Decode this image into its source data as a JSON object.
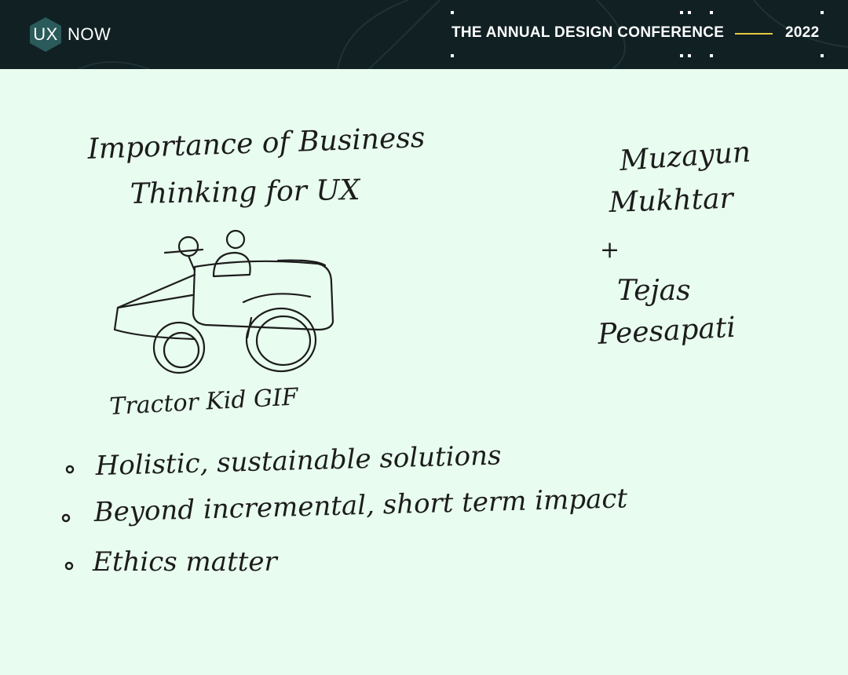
{
  "header": {
    "logo": {
      "ux": "UX",
      "now": "NOW"
    },
    "conference_title": "THE ANNUAL DESIGN CONFERENCE",
    "year": "2022"
  },
  "slide": {
    "title_line1": "Importance of Business",
    "title_line2": "Thinking for UX",
    "sketch_caption": "Tractor Kid GIF",
    "speakers": {
      "speaker1_first": "Muzayun",
      "speaker1_last": "Mukhtar",
      "joiner": "+",
      "speaker2_first": "Tejas",
      "speaker2_last": "Peesapati"
    },
    "bullets": [
      "Holistic, sustainable solutions",
      "Beyond incremental, short term impact",
      "Ethics matter"
    ]
  },
  "colors": {
    "header_bg": "#112023",
    "accent": "#e8c940",
    "logo_hex": "#2b5a5a",
    "page_bg": "#e8fcef",
    "ink": "#1c1c1c"
  }
}
